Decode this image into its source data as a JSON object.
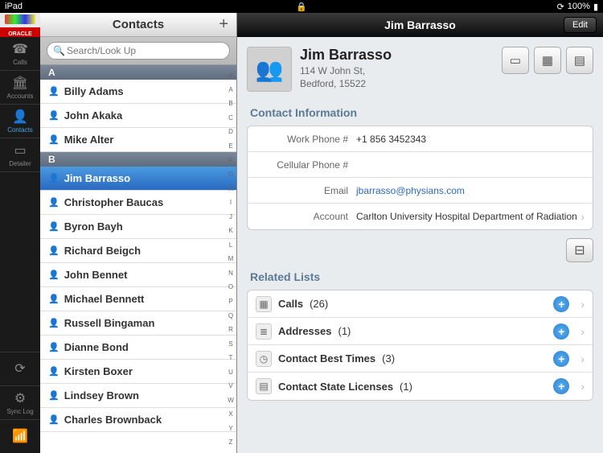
{
  "statusbar": {
    "device": "iPad",
    "battery": "100%",
    "lock": "🔒",
    "rotate": "⟳"
  },
  "brand": "ORACLE",
  "nav": [
    {
      "icon": "☎",
      "label": "Calls"
    },
    {
      "icon": "🏛",
      "label": "Accounts"
    },
    {
      "icon": "👤",
      "label": "Contacts",
      "active": true
    },
    {
      "icon": "▭",
      "label": "Detailer"
    }
  ],
  "navBottom": [
    {
      "icon": "⟳",
      "label": ""
    },
    {
      "icon": "⚙",
      "label": "Sync Log"
    },
    {
      "icon": "📶",
      "label": "",
      "color": "green"
    }
  ],
  "list": {
    "title": "Contacts",
    "addLabel": "+",
    "searchPlaceholder": "Search/Look Up",
    "index": [
      "#",
      "A",
      "B",
      "C",
      "D",
      "E",
      "F",
      "G",
      "H",
      "I",
      "J",
      "K",
      "L",
      "M",
      "N",
      "O",
      "P",
      "Q",
      "R",
      "S",
      "T",
      "U",
      "V",
      "W",
      "X",
      "Y",
      "Z"
    ],
    "sections": [
      {
        "letter": "A",
        "rows": [
          "Billy Adams",
          "John Akaka",
          "Mike Alter"
        ]
      },
      {
        "letter": "B",
        "rows": [
          "Jim Barrasso",
          "Christopher Baucas",
          "Byron Bayh",
          "Richard Beigch",
          "John Bennet",
          "Michael Bennett",
          "Russell Bingaman",
          "Dianne Bond",
          "Kirsten Boxer",
          "Lindsey Brown",
          "Charles Brownback"
        ]
      }
    ],
    "selected": "Jim Barrasso"
  },
  "detail": {
    "headerTitle": "Jim Barrasso",
    "edit": "Edit",
    "name": "Jim Barrasso",
    "addr1": "114 W John St,",
    "addr2": "Bedford, 15522",
    "sectionContact": "Contact Information",
    "fields": {
      "workPhoneLabel": "Work Phone #",
      "workPhone": "+1 856 3452343",
      "cellLabel": "Cellular Phone #",
      "cell": "",
      "emailLabel": "Email",
      "email": "jbarrasso@physians.com",
      "accountLabel": "Account",
      "account": "Carlton University Hospital Department of Radiation"
    },
    "sectionRelated": "Related Lists",
    "related": [
      {
        "icon": "▦",
        "label": "Calls",
        "count": "(26)"
      },
      {
        "icon": "≣",
        "label": "Addresses",
        "count": "(1)"
      },
      {
        "icon": "◷",
        "label": "Contact Best Times",
        "count": "(3)"
      },
      {
        "icon": "▤",
        "label": "Contact State Licenses",
        "count": "(1)"
      }
    ]
  }
}
